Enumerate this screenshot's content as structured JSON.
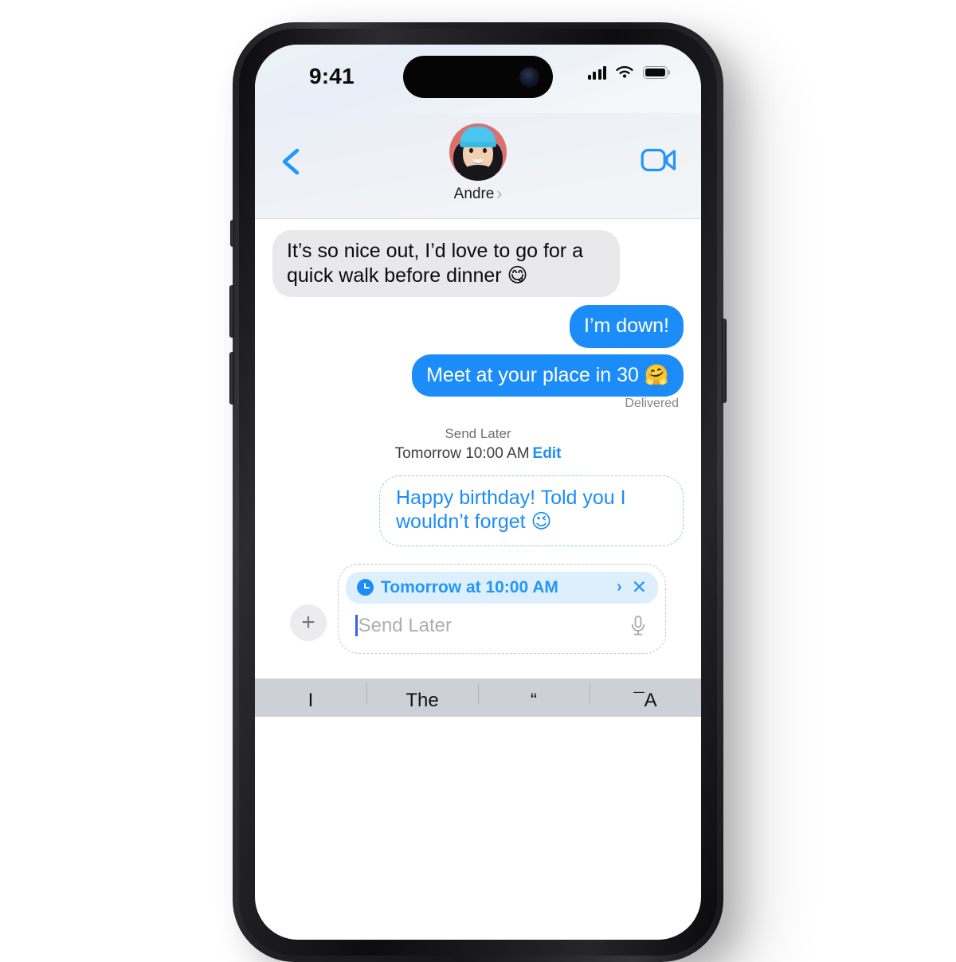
{
  "device": {
    "name": "iphone-15-pro",
    "frame_color": "#1d1d1f"
  },
  "status_bar": {
    "time": "9:41",
    "signal_icon": "cellular-signal-icon",
    "wifi_icon": "wifi-icon",
    "battery_icon": "battery-icon"
  },
  "nav_header": {
    "back_icon": "chevron-left-icon",
    "contact_name": "Andre",
    "contact_chevron": "›",
    "facetime_icon": "video-camera-icon",
    "avatar_name": "memoji-avatar"
  },
  "conversation": {
    "messages": [
      {
        "id": "msg-incoming-1",
        "direction": "incoming",
        "text": "It’s so nice out, I’d love to go for a quick walk before dinner 😋"
      },
      {
        "id": "msg-outgoing-1",
        "direction": "outgoing",
        "text": "I’m down!"
      },
      {
        "id": "msg-outgoing-2",
        "direction": "outgoing",
        "text": "Meet at your place in 30 🤗"
      }
    ],
    "delivered_status": "Delivered"
  },
  "send_later": {
    "title": "Send Later",
    "scheduled_when": "Tomorrow 10:00 AM",
    "edit_label": "Edit",
    "scheduled_message": "Happy birthday! Told you I wouldn’t forget 😉"
  },
  "composer": {
    "add_attachment_icon": "plus-icon",
    "schedule_chip": {
      "clock_icon": "clock-icon",
      "label": "Tomorrow at 10:00 AM",
      "chevron": "›",
      "clear_icon": "close-x-icon"
    },
    "input_placeholder": "Send Later",
    "input_value": "",
    "mic_icon": "microphone-icon"
  },
  "keyboard": {
    "predictions": [
      "I",
      "The",
      "“",
      "¯A"
    ]
  },
  "colors": {
    "imessage_blue": "#1c8cf8",
    "incoming_grey": "#e9e9eb",
    "chip_blue_bg": "#ddeffd",
    "dashed_border_blue": "#8fcbf8",
    "dashed_border_grey": "#c7c7cc",
    "avatar_bg": "#d9716f",
    "beanie_blue": "#49c7f0"
  }
}
